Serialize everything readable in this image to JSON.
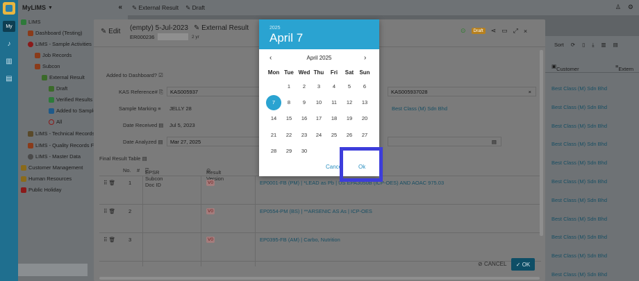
{
  "app": {
    "name": "MyLIMS",
    "rail_label": "My"
  },
  "topbar": {
    "crumb_1": "External Result",
    "crumb_2": "Draft"
  },
  "sidebar": {
    "items": [
      {
        "label": "LIMS",
        "icon": "flask-icon"
      },
      {
        "label": "Dashboard (Testing)",
        "icon": "person-icon"
      },
      {
        "label": "LIMS - Sample Activities",
        "icon": "refresh-icon"
      },
      {
        "label": "Job Records",
        "icon": "person-icon"
      },
      {
        "label": "Subcon",
        "icon": "person-icon"
      },
      {
        "label": "External Result",
        "icon": "pencil-icon"
      },
      {
        "label": "Draft",
        "icon": "pencil-icon"
      },
      {
        "label": "Verified Results",
        "icon": "check-icon"
      },
      {
        "label": "Added to Sample",
        "icon": "square-icon"
      },
      {
        "label": "All",
        "icon": "circle-icon"
      },
      {
        "label": "LIMS - Technical Records F...",
        "icon": "tools-icon"
      },
      {
        "label": "LIMS - Quality Records For...",
        "icon": "person-icon"
      },
      {
        "label": "LIMS - Master Data",
        "icon": "gear-icon"
      },
      {
        "label": "Customer Management",
        "icon": "people-icon"
      },
      {
        "label": "Human Resources",
        "icon": "people-icon"
      },
      {
        "label": "Public Holiday",
        "icon": "calendar-icon"
      }
    ]
  },
  "bglist": {
    "sort_label": "Sort",
    "col_customer": "Customer",
    "col_extern": "Extern",
    "rows": [
      "Best Class (M) Sdn Bhd",
      "Best Class (M) Sdn Bhd",
      "Best Class (M) Sdn Bhd",
      "Best Class (M) Sdn Bhd",
      "Best Class (M) Sdn Bhd",
      "Best Class (M) Sdn Bhd",
      "Best Class (M) Sdn Bhd",
      "Best Class (M) Sdn Bhd",
      "Best Class (M) Sdn Bhd",
      "Best Class (M) Sdn Bhd",
      "Best Class (M) Sdn Bhd"
    ]
  },
  "dialog": {
    "edit_label": "Edit",
    "record_title": "(empty) 5-Jul-2023",
    "record_type": "External Result",
    "record_id": "ER000236",
    "age": "2 yr",
    "status_badge": "Draft",
    "fields": {
      "added_label": "Added to Dashboard?",
      "kas_label": "KAS Reference#",
      "kas_value": "KAS005937",
      "kas_value_2": "KAS005937028",
      "marking_label": "Sample Marking",
      "marking_value": "JELLY 28",
      "customer_value": "Best Class (M) Sdn Bhd",
      "received_label": "Date Received",
      "received_value": "Jul 5, 2023",
      "analyzed_label": "Date Analyzed",
      "analyzed_value": "Mar 27, 2025"
    },
    "table": {
      "title": "Final Result Table",
      "col_no": "No.",
      "col_hash": "#",
      "col_doc": "EPSR Subcon Doc ID",
      "col_version": "Result Version",
      "rows": [
        {
          "no": "1",
          "version": "V0",
          "result": "EP0001-FB (PM) | *LEAD as Pb | US EPA3050B (ICP-OES) AND AOAC 975.03"
        },
        {
          "no": "2",
          "version": "V0",
          "result": "EP0554-PM (BS) | **ARSENIC AS As | ICP-OES"
        },
        {
          "no": "3",
          "version": "V0",
          "result": "EP0395-FB (AM) | Carbo, Nutrition"
        }
      ]
    },
    "cancel_label": "CANCEL",
    "ok_label": "OK"
  },
  "picker": {
    "year": "2025",
    "selected_date": "April 7",
    "month_label": "April 2025",
    "weekdays": [
      "Mon",
      "Tue",
      "Wed",
      "Thu",
      "Fri",
      "Sat",
      "Sun"
    ],
    "days": [
      [
        "",
        "1",
        "2",
        "3",
        "4",
        "5",
        "6"
      ],
      [
        "7",
        "8",
        "9",
        "10",
        "11",
        "12",
        "13"
      ],
      [
        "14",
        "15",
        "16",
        "17",
        "18",
        "19",
        "20"
      ],
      [
        "21",
        "22",
        "23",
        "24",
        "25",
        "26",
        "27"
      ],
      [
        "28",
        "29",
        "30",
        "",
        "",
        "",
        ""
      ]
    ],
    "selected_day": "7",
    "cancel_label": "Cancel",
    "ok_label": "Ok"
  }
}
